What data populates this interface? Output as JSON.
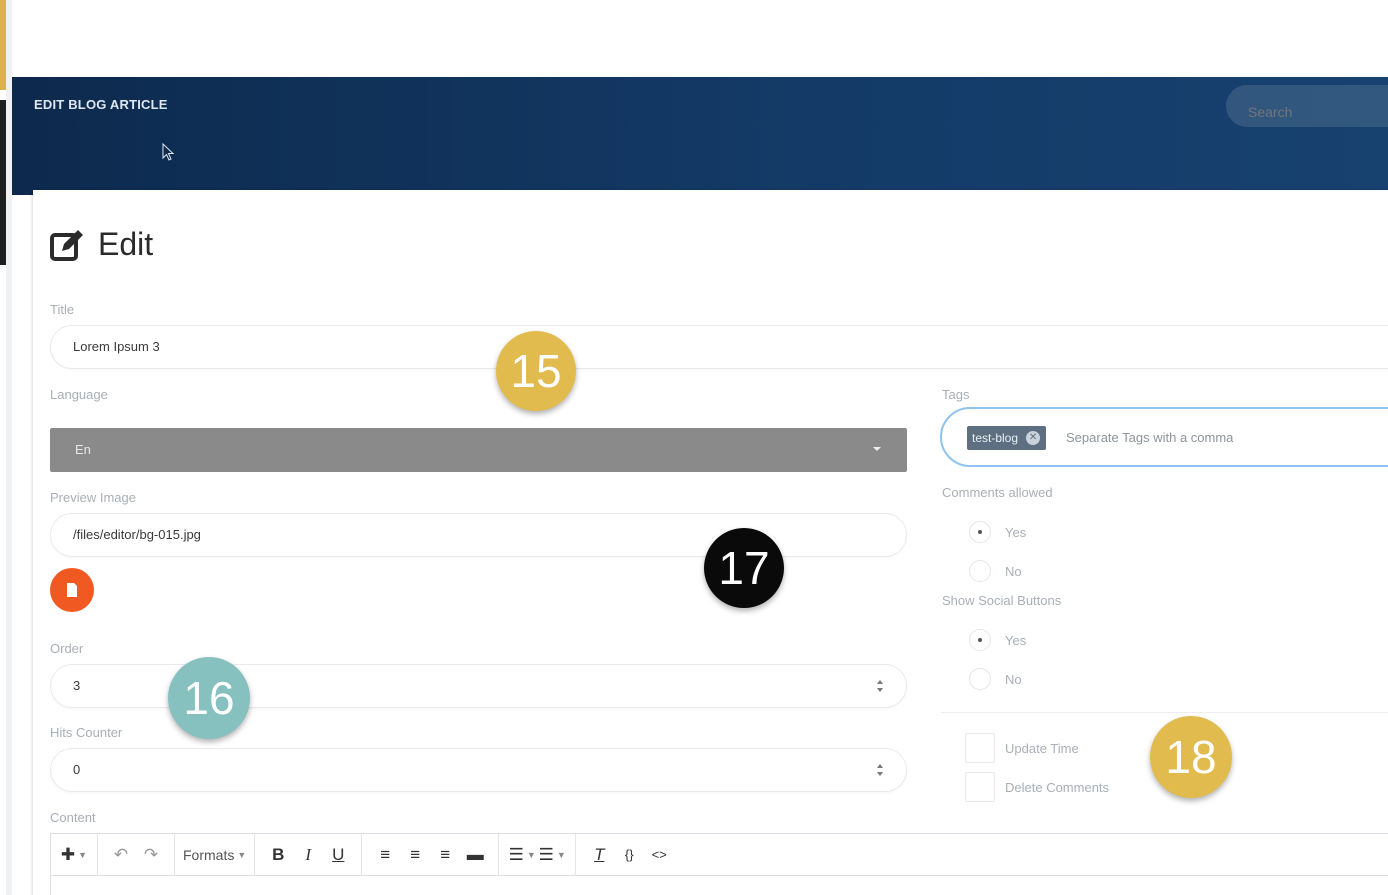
{
  "header": {
    "title": "EDIT BLOG ARTICLE",
    "search_placeholder": "Search"
  },
  "page": {
    "heading": "Edit"
  },
  "form": {
    "title_label": "Title",
    "title_value": "Lorem Ipsum 3",
    "language_label": "Language",
    "language_value": "En",
    "preview_label": "Preview Image",
    "preview_value": "/files/editor/bg-015.jpg",
    "order_label": "Order",
    "order_value": "3",
    "hits_label": "Hits Counter",
    "hits_value": "0",
    "content_label": "Content",
    "tags_label": "Tags",
    "tag_chip": "test-blog",
    "tags_placeholder": "Separate Tags with a comma",
    "comments_label": "Comments allowed",
    "comments_yes": "Yes",
    "comments_no": "No",
    "social_label": "Show Social Buttons",
    "social_yes": "Yes",
    "social_no": "No",
    "update_time": "Update Time",
    "delete_comments": "Delete Comments"
  },
  "editor": {
    "formats_label": "Formats"
  },
  "badges": {
    "b15": "15",
    "b16": "16",
    "b17": "17",
    "b18": "18"
  },
  "colors": {
    "header_bg": "#0d2a4d",
    "accent_orange": "#f05a22",
    "badge_gold": "#e2bb4e",
    "badge_teal": "#86c0bf",
    "badge_black": "#0a0a0a"
  }
}
